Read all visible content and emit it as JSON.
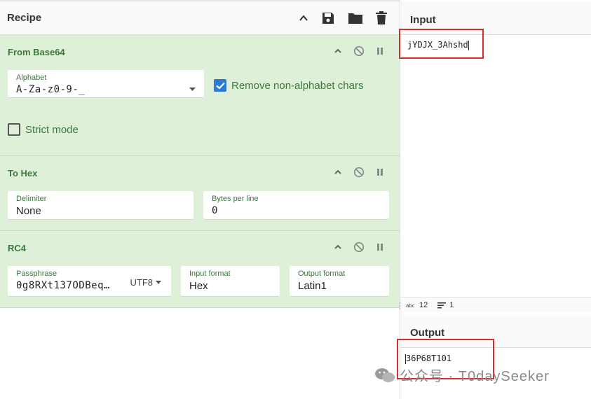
{
  "recipe": {
    "title": "Recipe",
    "operations": [
      {
        "name": "From Base64",
        "alphabet_label": "Alphabet",
        "alphabet_value": "A-Za-z0-9-_",
        "remove_label": "Remove non-alphabet chars",
        "remove_checked": true,
        "strict_label": "Strict mode",
        "strict_checked": false
      },
      {
        "name": "To Hex",
        "delimiter_label": "Delimiter",
        "delimiter_value": "None",
        "bytes_label": "Bytes per line",
        "bytes_value": "0"
      },
      {
        "name": "RC4",
        "passphrase_label": "Passphrase",
        "passphrase_value": "0g8RXt137ODBeq…",
        "passphrase_encoding": "UTF8",
        "input_format_label": "Input format",
        "input_format_value": "Hex",
        "output_format_label": "Output format",
        "output_format_value": "Latin1"
      }
    ]
  },
  "input": {
    "title": "Input",
    "text": "jYDJX_3Ahshd",
    "length": "12",
    "lines": "1"
  },
  "output": {
    "title": "Output",
    "text": "36P68T101"
  },
  "watermark": {
    "text": "公众号 · T0daySeeker"
  },
  "colors": {
    "op_bg": "#dff0d8",
    "op_text": "#3c763d",
    "highlight": "#d32f2f",
    "checkbox": "#2b7bd6"
  }
}
